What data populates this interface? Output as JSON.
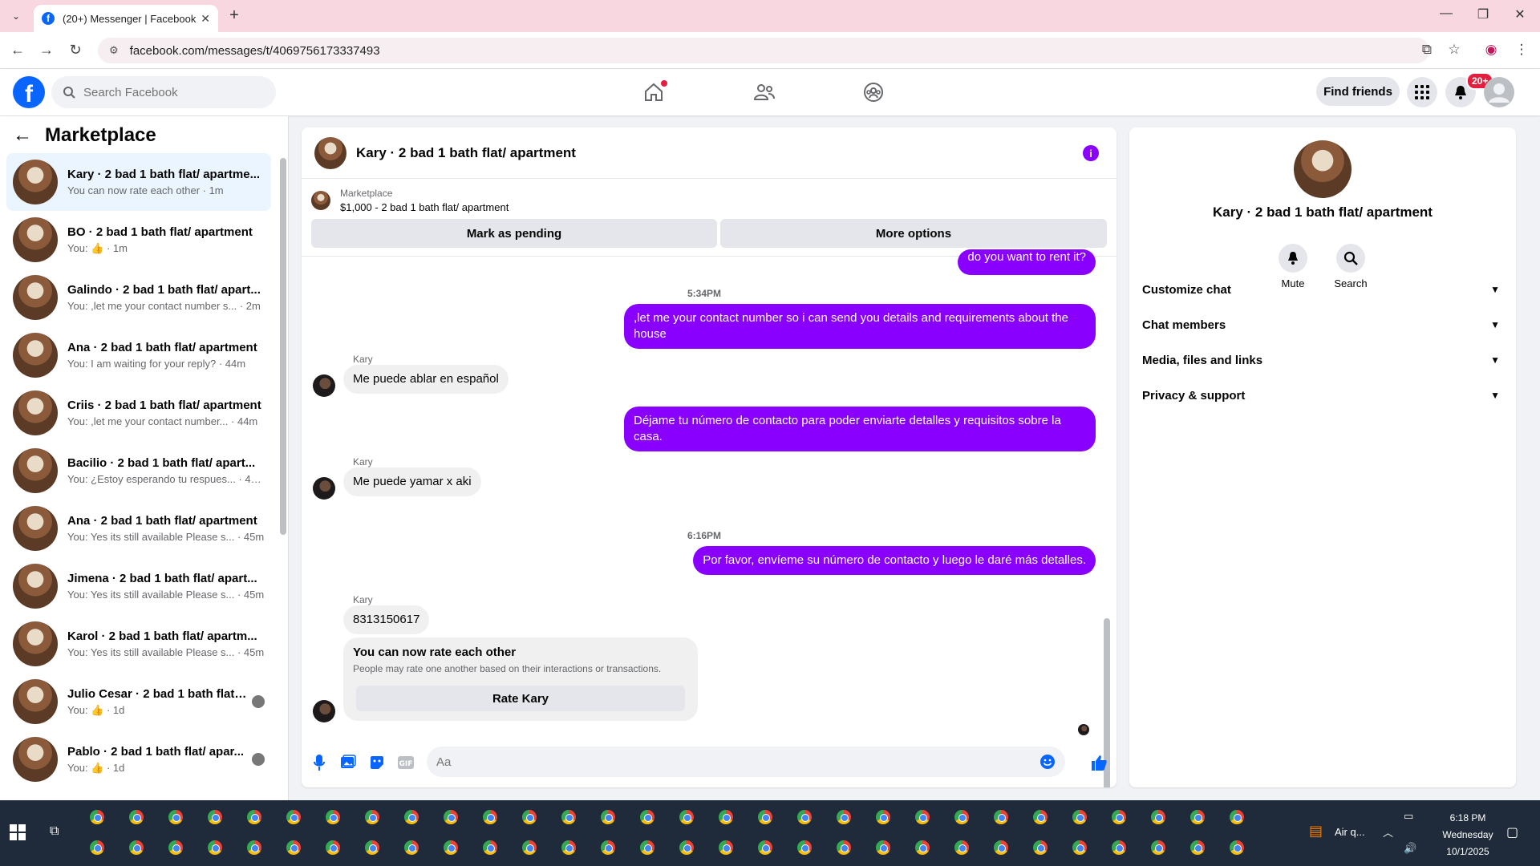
{
  "browser": {
    "tab_title": "(20+) Messenger | Facebook",
    "url": "facebook.com/messages/t/4069756173337493"
  },
  "fbnav": {
    "search_placeholder": "Search Facebook",
    "find_friends": "Find friends",
    "notif_badge": "20+"
  },
  "sidebar": {
    "title": "Marketplace",
    "chats": [
      {
        "name": "Kary · 2 bad 1 bath flat/ apartme...",
        "preview": "You can now rate each other · 1m",
        "active": true
      },
      {
        "name": "BO · 2 bad 1 bath flat/ apartment",
        "preview": "You: 👍 · 1m"
      },
      {
        "name": "Galindo · 2 bad 1 bath flat/ apart...",
        "preview": "You: ,let me your contact number s... · 2m"
      },
      {
        "name": "Ana · 2 bad 1 bath flat/ apartment",
        "preview": "You: I am waiting for your reply? · 44m"
      },
      {
        "name": "Criis · 2 bad 1 bath flat/ apartment",
        "preview": "You: ,let me your contact number... · 44m"
      },
      {
        "name": "Bacilio · 2 bad 1 bath flat/ apart...",
        "preview": "You: ¿Estoy esperando tu respues... · 44m"
      },
      {
        "name": "Ana · 2 bad 1 bath flat/ apartment",
        "preview": "You: Yes its still available Please s... · 45m"
      },
      {
        "name": "Jimena · 2 bad 1 bath flat/ apart...",
        "preview": "You: Yes its still available Please s... · 45m"
      },
      {
        "name": "Karol · 2 bad 1 bath flat/ apartm...",
        "preview": "You: Yes its still available Please s... · 45m"
      },
      {
        "name": "Julio Cesar · 2 bad 1 bath flat/ ...",
        "preview": "You: 👍 · 1d"
      },
      {
        "name": "Pablo · 2 bad 1 bath flat/ apar...",
        "preview": "You: 👍 · 1d"
      }
    ]
  },
  "chat": {
    "title": "Kary · 2 bad 1 bath flat/ apartment",
    "marketplace_label": "Marketplace",
    "listing": "$1,000 - 2 bad 1 bath flat/ apartment",
    "mark_pending": "Mark as pending",
    "more_options": "More options",
    "top_partial": "do you want to rent it?",
    "ts1": "5:34PM",
    "out1": ",let me your contact number so i can send you details and requirements about the house",
    "sender": "Kary",
    "in1": "Me puede ablar en español",
    "out2": "Déjame tu número de contacto para poder enviarte detalles y requisitos sobre la casa.",
    "in2": "Me puede yamar x aki",
    "ts2": "6:16PM",
    "out3": "Por favor, envíeme su número de contacto y luego le daré más detalles.",
    "in3": "8313150617",
    "rate_title": "You can now rate each other",
    "rate_sub": "People may rate one another based on their interactions or transactions.",
    "rate_btn": "Rate Kary",
    "composer_placeholder": "Aa"
  },
  "info": {
    "name": "Kary · 2 bad 1 bath flat/ apartment",
    "mute": "Mute",
    "search": "Search",
    "rows": [
      "Customize chat",
      "Chat members",
      "Media, files and links",
      "Privacy & support"
    ]
  },
  "taskbar": {
    "weather": "Air q...",
    "time": "6:18 PM",
    "day": "Wednesday",
    "date": "10/1/2025"
  },
  "colors": {
    "fb_blue": "#0866ff",
    "messenger_purple": "#8a00ff",
    "notif_red": "#e41e3f"
  }
}
